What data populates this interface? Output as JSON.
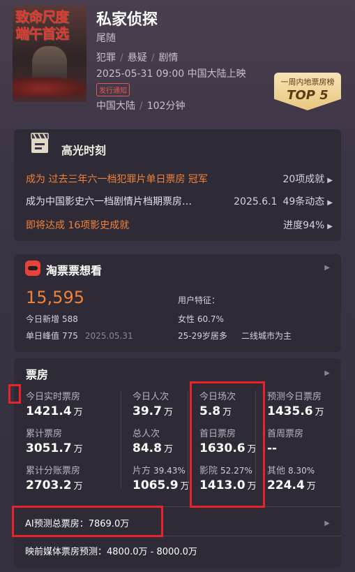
{
  "header": {
    "poster_text": "致命尺度 端午首选",
    "title": "私家侦探",
    "subtitle": "尾随",
    "genres": [
      "犯罪",
      "悬疑",
      "剧情"
    ],
    "release": "2025-05-31 09:00 中国大陆上映",
    "notice": "发行通知",
    "region": "中国大陆",
    "duration": "102分钟",
    "badge_top": "一周内地票房榜",
    "badge_main": "TOP 5"
  },
  "highlights": {
    "title": "高光时刻",
    "rows": [
      {
        "prefix": "成为 ",
        "accent": "过去三年六一档犯罪片单日票房",
        "suffix": " 冠军",
        "right": "20项成就"
      },
      {
        "prefix": "成为中国影史六一档剧情片档期票房…",
        "accent": "",
        "suffix": "",
        "date": "2025.6.1",
        "right": "49条动态"
      },
      {
        "prefix": "即将达成 16项影史成就",
        "accent": "",
        "suffix": "",
        "right": "进度94%"
      }
    ]
  },
  "taopiao": {
    "title": "淘票票想看",
    "count": "15,595",
    "today_new_label": "今日新增",
    "today_new": "588",
    "peak_label": "单日峰值",
    "peak": "775",
    "peak_date": "2025.05.31",
    "user_feature_label": "用户特征：",
    "female": "女性 60.7%",
    "age": "25-29岁居多",
    "city": "二线城市为主"
  },
  "boxoffice": {
    "title": "票房",
    "cells": [
      {
        "label": "今日实时票房",
        "value": "1421.4",
        "unit": "万"
      },
      {
        "label": "今日人次",
        "value": "39.7",
        "unit": "万"
      },
      {
        "label": "今日场次",
        "value": "5.8",
        "unit": "万"
      },
      {
        "label": "预测今日票房",
        "value": "1435.6",
        "unit": "万"
      },
      {
        "label": "累计票房",
        "value": "3051.7",
        "unit": "万"
      },
      {
        "label": "总人次",
        "value": "84.8",
        "unit": "万"
      },
      {
        "label": "首日票房",
        "value": "1630.6",
        "unit": "万"
      },
      {
        "label": "首周票房",
        "value": "--",
        "unit": ""
      },
      {
        "label": "累计分账票房",
        "value": "2703.2",
        "unit": "万"
      },
      {
        "label": "片方",
        "pct": "39.43%",
        "value": "1065.9",
        "unit": "万"
      },
      {
        "label": "影院",
        "pct": "52.27%",
        "value": "1413.0",
        "unit": "万"
      },
      {
        "label": "其他",
        "pct": "8.30%",
        "value": "224.4",
        "unit": "万"
      }
    ],
    "ai_prediction": "AI预测总票房：7869.0万",
    "pre_prediction": "映前媒体票房预测：4800.0万 - 8000.0万"
  }
}
